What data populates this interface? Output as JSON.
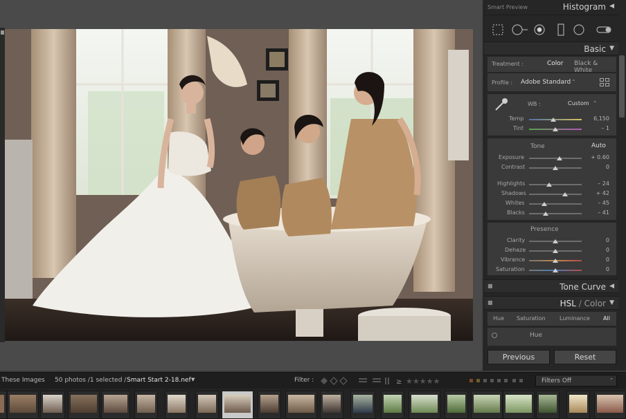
{
  "histogram": {
    "label": "Smart Preview",
    "title": "Histogram"
  },
  "basic": {
    "title": "Basic",
    "treatment_label": "Treatment :",
    "treatment_color": "Color",
    "treatment_bw": "Black & White",
    "profile_label": "Profile :",
    "profile_value": "Adobe Standard",
    "wb_label": "WB :",
    "wb_value": "Custom",
    "temp_label": "Temp",
    "temp_value": "6,150",
    "tint_label": "Tint",
    "tint_value": "– 1",
    "tone_label": "Tone",
    "auto_label": "Auto",
    "exposure_label": "Exposure",
    "exposure_value": "+ 0.60",
    "contrast_label": "Contrast",
    "contrast_value": "0",
    "highlights_label": "Highlights",
    "highlights_value": "– 24",
    "shadows_label": "Shadows",
    "shadows_value": "+ 42",
    "whites_label": "Whites",
    "whites_value": "– 45",
    "blacks_label": "Blacks",
    "blacks_value": "– 41",
    "presence_label": "Presence",
    "clarity_label": "Clarity",
    "clarity_value": "0",
    "dehaze_label": "Dehaze",
    "dehaze_value": "0",
    "vibrance_label": "Vibrance",
    "vibrance_value": "0",
    "saturation_label": "Saturation",
    "saturation_value": "0"
  },
  "tone_curve": {
    "title": "Tone Curve"
  },
  "hsl": {
    "title_hsl": "HSL",
    "title_sep": " / ",
    "title_color": "Color",
    "tabs": [
      "Hue",
      "Saturation",
      "Luminance",
      "All"
    ],
    "hue_label": "Hue"
  },
  "buttons": {
    "previous": "Previous",
    "reset": "Reset"
  },
  "filterbar": {
    "source_prefix": "These Images",
    "count_text": "50 photos /1 selected /",
    "filename": "Smart Start 2-18.nef",
    "filter_label": "Filter :",
    "filters_off": "Filters Off"
  },
  "colors": {
    "panel_bg": "#262626",
    "section_bg": "#3a3a3a",
    "filmstrip_bg": "#232323",
    "selected_thumb": "#c9c9c9"
  }
}
